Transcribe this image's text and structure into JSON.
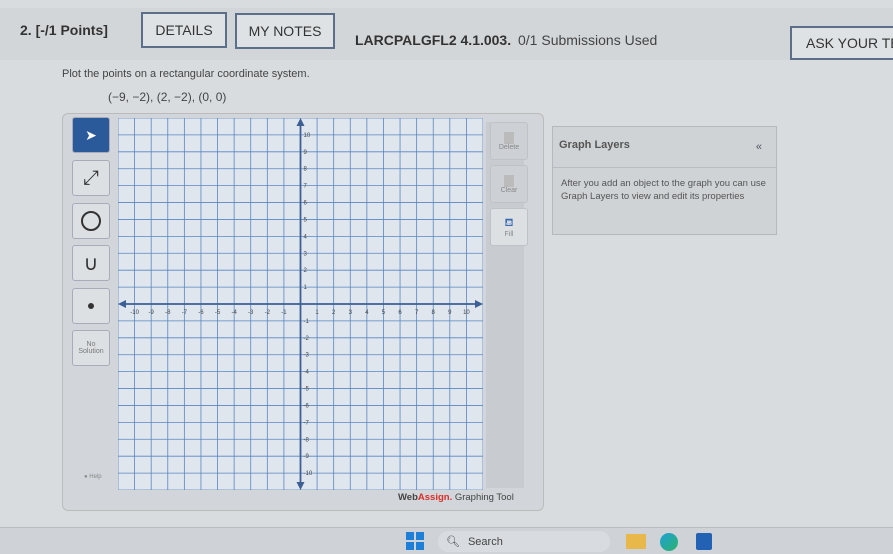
{
  "header": {
    "question": "2. [-/1 Points]",
    "details": "DETAILS",
    "notes": "MY NOTES",
    "code": "LARCPALGFL2 4.1.003.",
    "submissions": "0/1 Submissions Used",
    "ask": "ASK YOUR TEA"
  },
  "problem": {
    "prompt": "Plot the points on a rectangular coordinate system.",
    "points": "(−9, −2), (2, −2), (0, 0)"
  },
  "tools": {
    "no_solution": "No Solution",
    "help": "Help",
    "delete": "Delete",
    "clear": "Clear",
    "fill": "Fill"
  },
  "graph": {
    "xmin": -11,
    "xmax": 11,
    "ymin": -11,
    "ymax": 11,
    "ticks": [
      -10,
      -9,
      -8,
      -7,
      -6,
      -5,
      -4,
      -3,
      -2,
      -1,
      1,
      2,
      3,
      4,
      5,
      6,
      7,
      8,
      9,
      10
    ],
    "grid_color": "#5a86c0",
    "axis_color": "#3d5f95"
  },
  "brand": {
    "web": "Web",
    "assign": "Assign.",
    "rest": " Graphing Tool",
    "accent": "#d9302a"
  },
  "layers": {
    "title": "Graph Layers",
    "collapse": "«",
    "message": "After you add an object to the graph you can use Graph Layers to view and edit its properties"
  },
  "taskbar": {
    "search": "Search"
  }
}
